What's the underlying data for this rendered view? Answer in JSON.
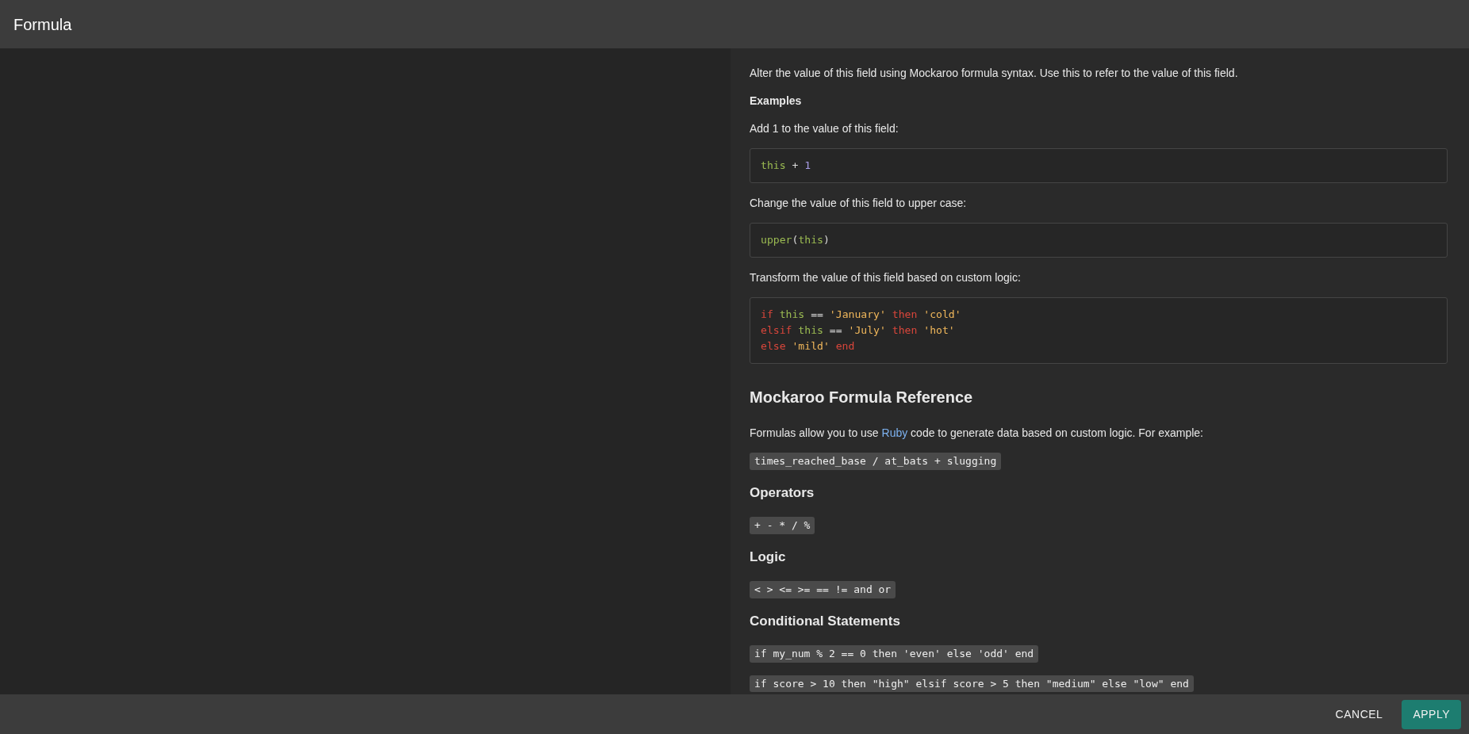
{
  "dialog": {
    "title": "Formula"
  },
  "content": [
    {
      "kind": "paragraph",
      "text": "Alter the value of this field using Mockaroo formula syntax. Use this to refer to the value of this field."
    },
    {
      "kind": "label",
      "text": "Examples"
    },
    {
      "kind": "paragraph",
      "text": "Add 1 to the value of this field:"
    },
    {
      "kind": "code_block",
      "lines": [
        [
          {
            "kind": "variable",
            "text": "this"
          },
          {
            "kind": "plain",
            "text": " + "
          },
          {
            "kind": "number",
            "text": "1"
          }
        ]
      ]
    },
    {
      "kind": "paragraph",
      "text": "Change the value of this field to upper case:"
    },
    {
      "kind": "code_block",
      "lines": [
        [
          {
            "kind": "function",
            "text": "upper"
          },
          {
            "kind": "plain",
            "text": "("
          },
          {
            "kind": "variable",
            "text": "this"
          },
          {
            "kind": "plain",
            "text": ")"
          }
        ]
      ]
    },
    {
      "kind": "paragraph",
      "text": "Transform the value of this field based on custom logic:"
    },
    {
      "kind": "code_block",
      "lines": [
        [
          {
            "kind": "keyword",
            "text": "if"
          },
          {
            "kind": "variable",
            "text": " this"
          },
          {
            "kind": "plain",
            "text": " == "
          },
          {
            "kind": "string",
            "text": "'January'"
          },
          {
            "kind": "keyword",
            "text": " then"
          },
          {
            "kind": "string",
            "text": " 'cold'"
          }
        ],
        [
          {
            "kind": "keyword",
            "text": "elsif"
          },
          {
            "kind": "variable",
            "text": " this"
          },
          {
            "kind": "plain",
            "text": " == "
          },
          {
            "kind": "string",
            "text": "'July'"
          },
          {
            "kind": "keyword",
            "text": " then"
          },
          {
            "kind": "string",
            "text": " 'hot'"
          }
        ],
        [
          {
            "kind": "keyword",
            "text": "else"
          },
          {
            "kind": "string",
            "text": " 'mild'"
          },
          {
            "kind": "keyword",
            "text": " end"
          }
        ]
      ]
    },
    {
      "kind": "heading",
      "text": "Mockaroo Formula Reference"
    },
    {
      "kind": "link_paragraph",
      "before": "Formulas allow you to use ",
      "link": "Ruby",
      "after": " code to generate data based on custom logic. For example:"
    },
    {
      "kind": "inline_code",
      "text": "times_reached_base / at_bats + slugging"
    },
    {
      "kind": "subheading",
      "text": "Operators"
    },
    {
      "kind": "inline_code",
      "text": "+ - * / %"
    },
    {
      "kind": "subheading",
      "text": "Logic"
    },
    {
      "kind": "inline_code",
      "text": "< > <= >= == != and or"
    },
    {
      "kind": "subheading",
      "text": "Conditional Statements"
    },
    {
      "kind": "inline_code",
      "text": "if my_num % 2 == 0 then 'even' else 'odd' end"
    },
    {
      "kind": "inline_code",
      "text": "if score > 10 then \"high\" elsif score > 5 then \"medium\" else \"low\" end"
    }
  ],
  "buttons": [
    {
      "kind": "text",
      "label": "CANCEL"
    },
    {
      "kind": "primary",
      "label": "APPLY"
    }
  ]
}
